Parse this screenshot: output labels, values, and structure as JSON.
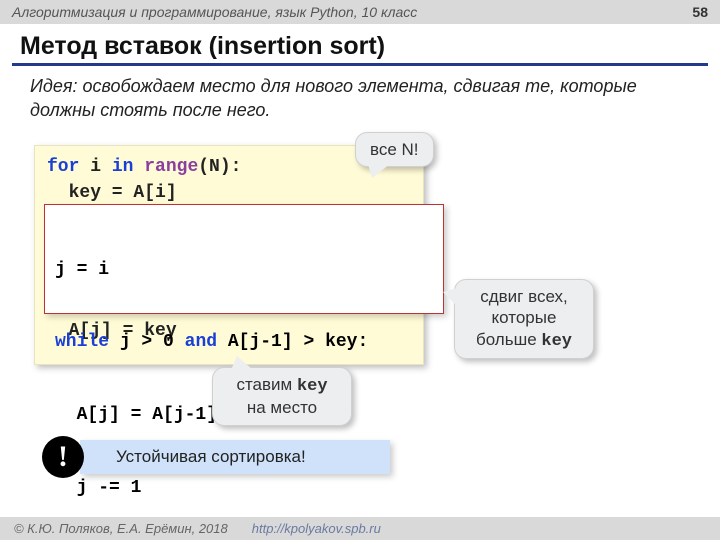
{
  "header": {
    "course": "Алгоритмизация и программирование, язык Python, 10 класс",
    "page": "58"
  },
  "title": "Метод вставок (insertion sort)",
  "idea": {
    "label": "Идея",
    "text": ": освобождаем место для нового элемента, сдвигая те, которые должны стоять после него."
  },
  "code": {
    "for": "for",
    "i": " i ",
    "in": "in",
    "sp": " ",
    "range": "range",
    "args": "(N):",
    "l2": "  key = A[i]",
    "inner_l1": "j = i",
    "while": "while",
    "cond1": " j > 0 ",
    "and": "and",
    "cond2": " A[j-1] > key:",
    "inner_l3": "  A[j] = A[j-1]:",
    "inner_l4": "  j -= 1",
    "last": "  A[j] = key"
  },
  "callouts": {
    "all_n": "все N!",
    "shift_l1": "сдвиг всех,",
    "shift_l2": "которые",
    "shift_l3_a": "больше ",
    "shift_l3_b": "key",
    "place_l1_a": "ставим ",
    "place_l1_b": "key",
    "place_l2": "на место"
  },
  "note": {
    "bang": "!",
    "text": "Устойчивая сортировка!"
  },
  "footer": {
    "copyright": "© К.Ю. Поляков, Е.А. Ерёмин, 2018",
    "url": "http://kpolyakov.spb.ru"
  }
}
